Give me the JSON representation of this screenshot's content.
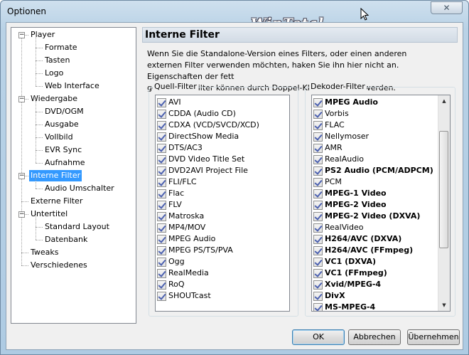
{
  "window": {
    "title": "Optionen",
    "watermark": "WinTotal",
    "close_glyph": "✕"
  },
  "tree": [
    {
      "label": "Player",
      "level": 0,
      "expander": "−"
    },
    {
      "label": "Formate",
      "level": 1
    },
    {
      "label": "Tasten",
      "level": 1
    },
    {
      "label": "Logo",
      "level": 1
    },
    {
      "label": "Web Interface",
      "level": 1
    },
    {
      "label": "Wiedergabe",
      "level": 0,
      "expander": "−"
    },
    {
      "label": "DVD/OGM",
      "level": 1
    },
    {
      "label": "Ausgabe",
      "level": 1
    },
    {
      "label": "Vollbild",
      "level": 1
    },
    {
      "label": "EVR Sync",
      "level": 1
    },
    {
      "label": "Aufnahme",
      "level": 1
    },
    {
      "label": "Interne Filter",
      "level": 0,
      "expander": "−",
      "selected": true
    },
    {
      "label": "Audio Umschalter",
      "level": 1
    },
    {
      "label": "Externe Filter",
      "level": 0
    },
    {
      "label": "Untertitel",
      "level": 0,
      "expander": "−"
    },
    {
      "label": "Standard Layout",
      "level": 1
    },
    {
      "label": "Datenbank",
      "level": 1
    },
    {
      "label": "Tweaks",
      "level": 0
    },
    {
      "label": "Verschiedenes",
      "level": 0
    }
  ],
  "panel": {
    "title": "Interne Filter",
    "description_lines": [
      "Wenn Sie die Standalone-Version eines Filters, oder einen anderen",
      "externen Filter verwenden möchten, haken Sie ihn hier nicht an. Eigenschaften der fett",
      "gedruckten Filter können durch Doppel-Klick angezeigt werden."
    ]
  },
  "source_filters": {
    "label": "Quell-Filter",
    "items": [
      {
        "label": "AVI",
        "checked": true
      },
      {
        "label": "CDDA (Audio CD)",
        "checked": true
      },
      {
        "label": "CDXA (VCD/SVCD/XCD)",
        "checked": true
      },
      {
        "label": "DirectShow Media",
        "checked": true
      },
      {
        "label": "DTS/AC3",
        "checked": true
      },
      {
        "label": "DVD Video Title Set",
        "checked": true
      },
      {
        "label": "DVD2AVI Project File",
        "checked": true
      },
      {
        "label": "FLI/FLC",
        "checked": true
      },
      {
        "label": "Flac",
        "checked": true
      },
      {
        "label": "FLV",
        "checked": true
      },
      {
        "label": "Matroska",
        "checked": true
      },
      {
        "label": "MP4/MOV",
        "checked": true
      },
      {
        "label": "MPEG Audio",
        "checked": true
      },
      {
        "label": "MPEG PS/TS/PVA",
        "checked": true
      },
      {
        "label": "Ogg",
        "checked": true
      },
      {
        "label": "RealMedia",
        "checked": true
      },
      {
        "label": "RoQ",
        "checked": true
      },
      {
        "label": "SHOUTcast",
        "checked": true
      }
    ]
  },
  "decoder_filters": {
    "label": "Dekoder-Filter",
    "items": [
      {
        "label": "MPEG Audio",
        "checked": true,
        "bold": true
      },
      {
        "label": "Vorbis",
        "checked": true
      },
      {
        "label": "FLAC",
        "checked": true
      },
      {
        "label": "Nellymoser",
        "checked": true
      },
      {
        "label": "AMR",
        "checked": true
      },
      {
        "label": "RealAudio",
        "checked": true
      },
      {
        "label": "PS2 Audio (PCM/ADPCM)",
        "checked": true,
        "bold": true
      },
      {
        "label": "PCM",
        "checked": true
      },
      {
        "label": "MPEG-1 Video",
        "checked": true,
        "bold": true
      },
      {
        "label": "MPEG-2 Video",
        "checked": true,
        "bold": true
      },
      {
        "label": "MPEG-2 Video (DXVA)",
        "checked": true,
        "bold": true
      },
      {
        "label": "RealVideo",
        "checked": true
      },
      {
        "label": "H264/AVC (DXVA)",
        "checked": true,
        "bold": true
      },
      {
        "label": "H264/AVC (FFmpeg)",
        "checked": true,
        "bold": true
      },
      {
        "label": "VC1 (DXVA)",
        "checked": true,
        "bold": true
      },
      {
        "label": "VC1 (FFmpeg)",
        "checked": true,
        "bold": true
      },
      {
        "label": "Xvid/MPEG-4",
        "checked": true,
        "bold": true
      },
      {
        "label": "DivX",
        "checked": true,
        "bold": true
      },
      {
        "label": "MS-MPEG-4",
        "checked": true,
        "bold": true
      }
    ],
    "scroll_up_glyph": "▲",
    "scroll_down_glyph": "▼"
  },
  "buttons": {
    "ok": "OK",
    "cancel": "Abbrechen",
    "apply": "Übernehmen"
  }
}
